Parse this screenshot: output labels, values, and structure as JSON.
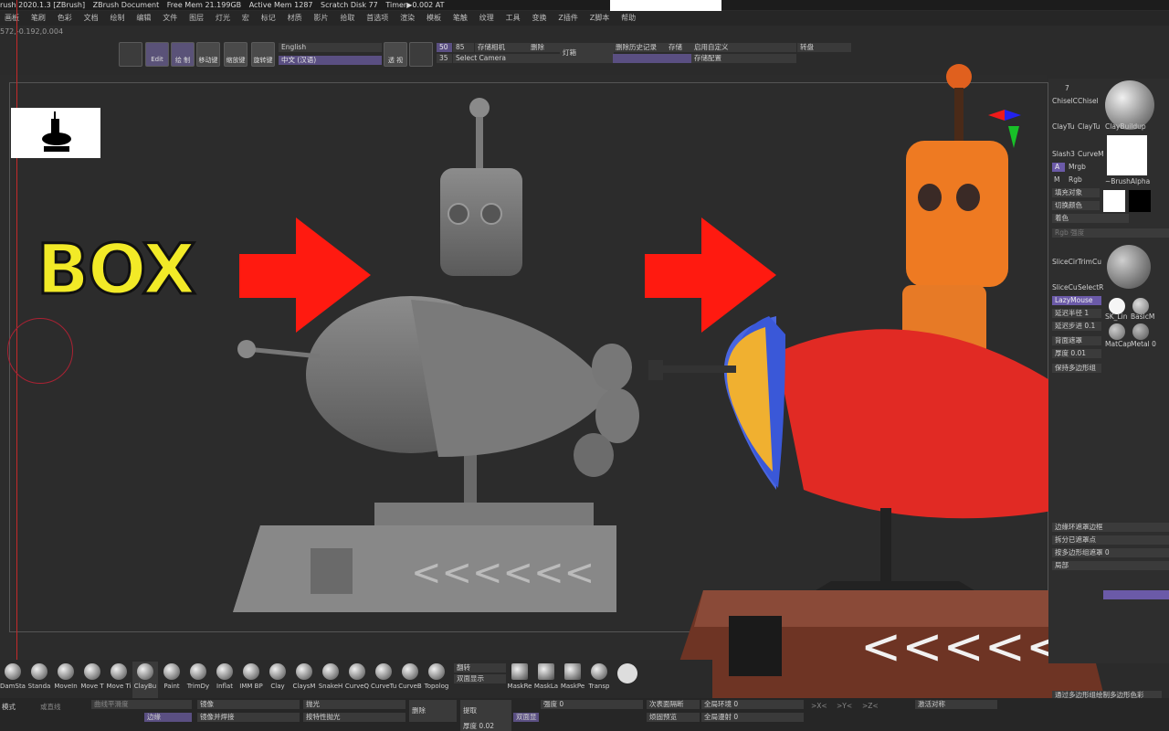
{
  "titlebar": {
    "app": "rush 2020.1.3 [ZBrush]",
    "document": "ZBrush Document",
    "free_mem": "Free Mem 21.199GB",
    "active_mem": "Active Mem 1287",
    "scratch_disk": "Scratch Disk 77",
    "timer": "Timer▶0.002 AT"
  },
  "menu": [
    "画板",
    "笔刷",
    "色彩",
    "文档",
    "绘制",
    "编辑",
    "文件",
    "图层",
    "灯光",
    "宏",
    "标记",
    "材质",
    "影片",
    "拾取",
    "首选项",
    "渲染",
    "模板",
    "笔触",
    "纹理",
    "工具",
    "变换",
    "Z插件",
    "Z脚本",
    "帮助"
  ],
  "coords": "572,-0.192,0.004",
  "toolbar": {
    "edit": "Edit",
    "draw": "绘 制",
    "move": "移动键",
    "scale": "缩放键",
    "rotate": "旋转键",
    "lang_en": "English",
    "lang_cn": "中文 (汉语)",
    "persp": "透 视",
    "num50": "50",
    "num85": "85",
    "num35": "35",
    "save_camera": "存储相机",
    "delete": "删除",
    "select_camera": "Select Camera",
    "light": "灯箱",
    "delete_history": "删除历史记录",
    "store": "存储",
    "custom": "启用自定义",
    "store_config": "存储配置",
    "turntable": "转盘"
  },
  "canvas": {
    "overlay_text": "BOX"
  },
  "rightpanel": {
    "brush_count": "7",
    "chisel1": "ChiselC",
    "chisel2": "Chisel",
    "claybuildup": "ClayBuildup",
    "claytube1": "ClayTu",
    "claytube2": "ClayTu",
    "slash": "Slash3",
    "curvem": "CurveM",
    "a_label": "A",
    "mrgb": "Mrgb",
    "m_label": "M",
    "rgb": "Rgb",
    "brushalpha": "~BrushAlpha",
    "fill_object": "填充对象",
    "switch_color": "切换颜色",
    "color_label": "着色",
    "rgb_intensity": "Rgb 强度",
    "slicecir": "SliceCir",
    "trimcu": "TrimCu",
    "slicecu": "SliceCu",
    "selectr": "SelectR",
    "lazymouse": "LazyMouse",
    "lazy_radius": "延迟半径 1",
    "lazy_step": "延迟步进 0.1",
    "back_mask": "背面遮罩",
    "thickness": "厚度 0.01",
    "sk_lin": "SK_Lin",
    "basicm": "BasicM",
    "matcap": "MatCap",
    "metal0": "Metal 0",
    "keep_poly": "保持多边形组",
    "edge_loop_mask": "边缘环遮罩边框",
    "split_mask": "拆分已遮罩点",
    "poly_mask": "按多边形组遮罩 0",
    "perspective": "局部",
    "paint_poly": "通过多边形组绘制多边形色彩"
  },
  "brushes": [
    {
      "label": "DamSta"
    },
    {
      "label": "Standa"
    },
    {
      "label": "MoveIn"
    },
    {
      "label": "Move T"
    },
    {
      "label": "Move Ti"
    },
    {
      "label": "ClayBu"
    },
    {
      "label": "Paint"
    },
    {
      "label": "TrimDy"
    },
    {
      "label": "Inflat"
    },
    {
      "label": "IMM BP"
    },
    {
      "label": "Clay"
    },
    {
      "label": "ClaysM"
    },
    {
      "label": "SnakeH"
    },
    {
      "label": "CurveQ"
    },
    {
      "label": "CurveTu"
    },
    {
      "label": "CurveB"
    },
    {
      "label": "Topolog"
    }
  ],
  "brush_extra": {
    "flip": "翻转",
    "double_display": "双面显示",
    "maskre": "MaskRe",
    "maskla": "MaskLa",
    "maskpe": "MaskPe",
    "transp": "Transp"
  },
  "bottom": {
    "mode": "模式",
    "clamp": "或直线",
    "curve_smooth": "曲线平滑度",
    "edge": "边缘",
    "mirror": "镜像",
    "mirror_weld": "镜像并焊接",
    "polish": "抛光",
    "polish_features": "按特性抛光",
    "delete": "删除",
    "extract": "提取",
    "intensity": "强度 0",
    "double_face": "双面显",
    "subdivide_next": "次表面隔断",
    "preview": "烦固预览",
    "global_ring": "全局环境 0",
    "global_reflect": "全局漫射 0",
    "activate_sym": "激活对称",
    "thickness": "厚度 0.02",
    "x_axis": ">X<",
    "y_axis": ">Y<",
    "z_axis": ">Z<"
  }
}
